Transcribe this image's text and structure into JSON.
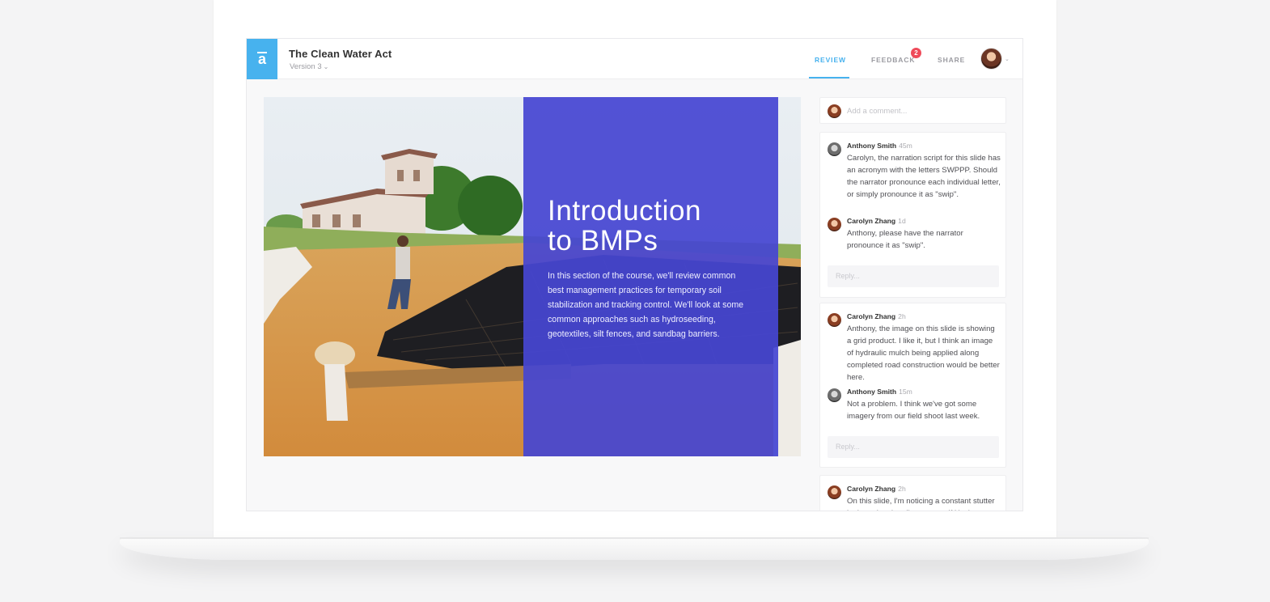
{
  "document": {
    "title": "The Clean Water Act",
    "version": "Version 3",
    "logo_glyph": "a"
  },
  "nav": {
    "tabs": [
      {
        "label": "REVIEW",
        "active": true
      },
      {
        "label": "FEEDBACK",
        "badge": "2"
      },
      {
        "label": "SHARE"
      }
    ]
  },
  "colors": {
    "accent": "#47b2ee",
    "panel": "#4646d2",
    "badge": "#ef4b5a"
  },
  "slide": {
    "title_line1": "Introduction",
    "title_line2": "to BMPs",
    "body": "In this section of the course, we'll review common best management practices for temporary soil stabilization and tracking control. We'll look at some common approaches such as hydroseeding, geotextiles, silt fences, and sandbag barriers."
  },
  "comments": {
    "add_placeholder": "Add a comment...",
    "reply_placeholder": "Reply...",
    "threads": [
      {
        "messages": [
          {
            "author": "Anthony Smith",
            "time": "45m",
            "text": "Carolyn, the narration script for this slide has an acronym with the letters SWPPP. Should the narrator pronounce each individual letter, or simply pronounce it as \"swip\"."
          },
          {
            "author": "Carolyn Zhang",
            "time": "1d",
            "text": "Anthony, please have the narrator pronounce it as \"swip\"."
          }
        ]
      },
      {
        "messages": [
          {
            "author": "Carolyn Zhang",
            "time": "2h",
            "text": "Anthony, the image on this slide is showing a grid product. I like it, but I think an image of hydraulic mulch being applied along completed road construction would be better here."
          },
          {
            "author": "Anthony Smith",
            "time": "15m",
            "text": "Not a problem. I think we've got some imagery from our field shoot last week."
          }
        ]
      },
      {
        "messages": [
          {
            "author": "Carolyn Zhang",
            "time": "2h",
            "text": "On this slide, I'm noticing a constant stutter in the animation. I'm not sure if it's the"
          }
        ]
      }
    ]
  }
}
